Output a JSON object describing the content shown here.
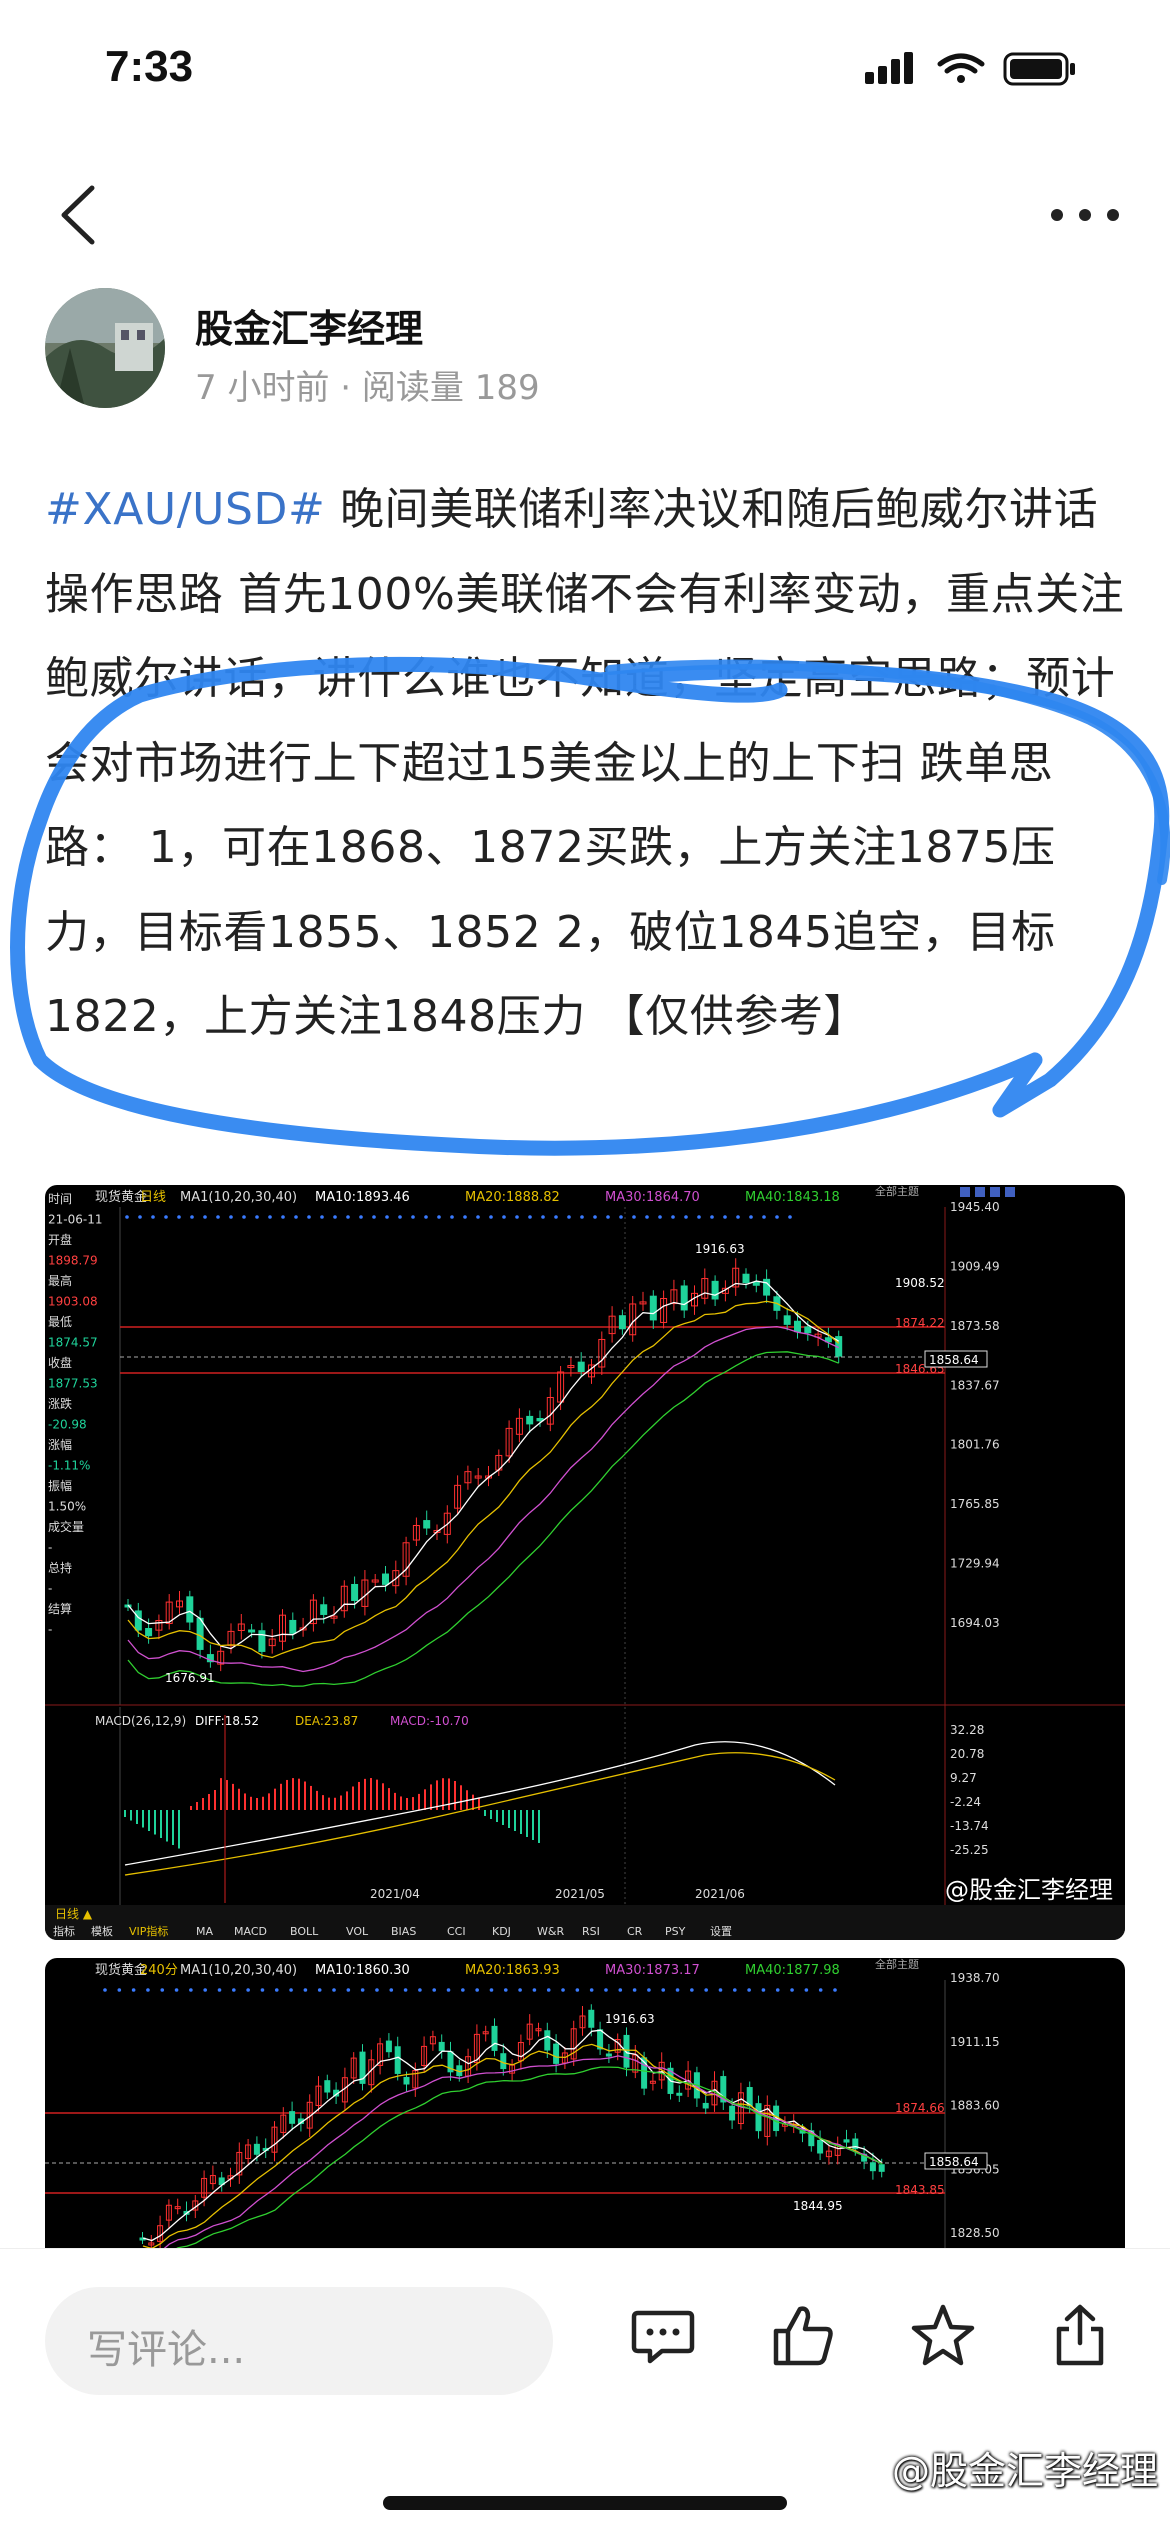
{
  "status_bar": {
    "time": "7:33"
  },
  "author": {
    "name": "股金汇李经理",
    "time_ago": "7 小时前",
    "separator": "·",
    "reads": "阅读量 189"
  },
  "post": {
    "hashtag": "#XAU/USD#",
    "text": " 晚间美联储利率决议和随后鲍威尔讲话操作思路 首先100%美联储不会有利率变动，重点关注鲍威尔讲话，讲什么谁也不知道，坚定高空思路；预计会对市场进行上下超过15美金以上的上下扫 跌单思路： 1，可在1868、1872买跌，上方关注1875压力，目标看1855、1852 2，破位1845追空，目标1822，上方关注1848压力 【仅供参考】"
  },
  "chart1": {
    "title": "现货黄金",
    "period": "日线",
    "ma_legend": {
      "ma1": "MA1(10,20,30,40)",
      "ma10": "MA10:1893.46",
      "ma20": "MA20:1888.82",
      "ma30": "MA30:1864.70",
      "ma40": "MA40:1843.18"
    },
    "theme_label": "全部主题",
    "side_panel": {
      "time_label": "时间",
      "date": "21-06-11",
      "open_label": "开盘",
      "open": "1898.79",
      "high_label": "最高",
      "high": "1903.08",
      "low_label": "最低",
      "low": "1874.57",
      "close_label": "收盘",
      "close": "1877.53",
      "change_label": "涨跌",
      "change": "-20.98",
      "pct_label": "涨幅",
      "pct": "-1.11%",
      "amp_label": "振幅",
      "amp": "1.50%",
      "vol_label": "成交量",
      "vol": "-",
      "hold_label": "总持",
      "hold": "-",
      "settle_label": "结算",
      "settle": "-"
    },
    "y_ticks": [
      "1945.40",
      "1909.49",
      "1873.58",
      "1837.67",
      "1801.76",
      "1765.85",
      "1729.94",
      "1694.03"
    ],
    "price_tags": [
      "1908.52",
      "1874.22",
      "1846.65",
      "1858.64"
    ],
    "high_label": "1916.63",
    "low_label": "1676.91",
    "macd_legend": {
      "name": "MACD(26,12,9)",
      "diff": "DIFF:18.52",
      "dea": "DEA:23.87",
      "macd": "MACD:-10.70"
    },
    "macd_ticks": [
      "32.28",
      "20.78",
      "9.27",
      "-2.24",
      "-13.74",
      "-25.25"
    ],
    "x_labels": [
      "2021/04",
      "2021/05",
      "2021/06"
    ],
    "period_tab": "日线 ▲",
    "tabs": [
      "指标",
      "模板",
      "VIP指标",
      "MA",
      "MACD",
      "BOLL",
      "VOL",
      "BIAS",
      "CCI",
      "KDJ",
      "W&R",
      "RSI",
      "CR",
      "PSY",
      "设置"
    ],
    "watermark": "@股金汇李经理"
  },
  "chart2": {
    "title": "现货黄金",
    "period": "240分",
    "ma_legend": {
      "ma1": "MA1(10,20,30,40)",
      "ma10": "MA10:1860.30",
      "ma20": "MA20:1863.93",
      "ma30": "MA30:1873.17",
      "ma40": "MA40:1877.98"
    },
    "theme_label": "全部主题",
    "y_ticks": [
      "1938.70",
      "1911.15",
      "1883.60",
      "1856.05",
      "1828.50"
    ],
    "price_tags": [
      "1874.66",
      "1858.64",
      "1843.85"
    ],
    "high_label": "1916.63",
    "low_label": "1844.95"
  },
  "bottom_bar": {
    "comment_placeholder": "写评论..."
  },
  "watermark": "@股金汇李经理",
  "colors": {
    "hashtag": "#3a73c8",
    "up": "#ff3030",
    "down": "#1fd39a",
    "scribble": "#2f86f0"
  }
}
